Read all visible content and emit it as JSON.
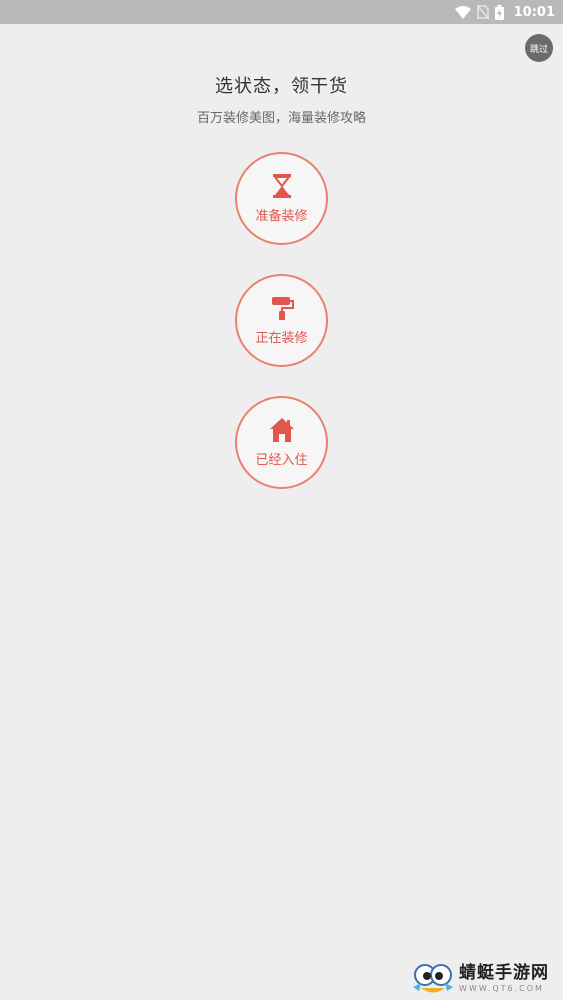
{
  "status_bar": {
    "time": "10:01",
    "icons": [
      "wifi-icon",
      "no-sim-icon",
      "battery-charging-icon"
    ]
  },
  "skip_button": {
    "label": "跳过"
  },
  "header": {
    "title": "选状态，领干货",
    "subtitle": "百万装修美图，海量装修攻略"
  },
  "options": [
    {
      "label": "准备装修",
      "icon": "hourglass-icon"
    },
    {
      "label": "正在装修",
      "icon": "paint-roller-icon"
    },
    {
      "label": "已经入住",
      "icon": "house-icon"
    }
  ],
  "watermark": {
    "name": "蜻蜓手游网",
    "url": "WWW.QT6.COM"
  },
  "colors": {
    "accent": "#e2574c",
    "circle_border": "#e8826f",
    "background": "#eeeeee",
    "status_bar": "#b9b9b9"
  }
}
